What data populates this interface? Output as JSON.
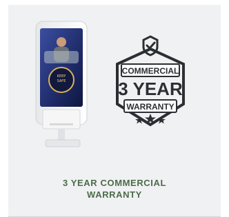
{
  "product": {
    "title_line1": "3 YEAR COMMERCIAL",
    "title_line2": "WARRANTY",
    "badge": {
      "top": "COMMERCIAL",
      "middle": "3 YEAR",
      "bottom": "WARRANTY"
    },
    "kiosk_image_label": "Digital hand sanitizer kiosk"
  },
  "colors": {
    "card_bg": "#f0f1f2",
    "title_green": "#4c6b4b",
    "badge_dark": "#2b2f33"
  },
  "icons": [
    "check-shield-icon",
    "stars-icon"
  ]
}
